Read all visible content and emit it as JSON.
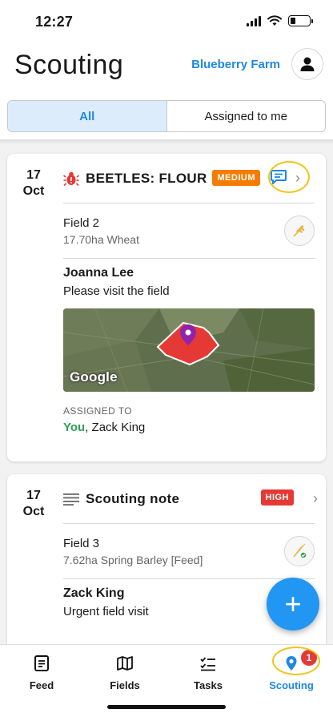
{
  "status_bar": {
    "time": "12:27"
  },
  "header": {
    "title": "Scouting",
    "farm_name": "Blueberry Farm"
  },
  "filter_tabs": [
    {
      "label": "All",
      "active": true
    },
    {
      "label": "Assigned to me",
      "active": false
    }
  ],
  "cards": [
    {
      "date_day": "17",
      "date_month": "Oct",
      "icon": "bug-icon",
      "title": "BEETLES: FLOUR",
      "severity": "MEDIUM",
      "field_name": "Field 2",
      "field_desc": "17.70ha Wheat",
      "author": "Joanna Lee",
      "message": "Please visit the field",
      "map_brand": "Google",
      "assigned_label": "ASSIGNED TO",
      "assigned_you": "You",
      "assigned_others": ", Zack King"
    },
    {
      "date_day": "17",
      "date_month": "Oct",
      "icon": "note-lines-icon",
      "title": "Scouting note",
      "severity": "HIGH",
      "field_name": "Field 3",
      "field_desc": "7.62ha Spring Barley [Feed]",
      "author": "Zack King",
      "message": "Urgent field visit"
    }
  ],
  "fab": {
    "label": "+"
  },
  "bottom_nav": {
    "items": [
      {
        "label": "Feed",
        "icon": "feed-doc-icon"
      },
      {
        "label": "Fields",
        "icon": "map-icon"
      },
      {
        "label": "Tasks",
        "icon": "checklist-icon"
      },
      {
        "label": "Scouting",
        "icon": "location-pin-icon",
        "badge": "1",
        "active": true
      }
    ]
  },
  "colors": {
    "accent": "#1e88e5",
    "medium": "#f57c00",
    "high": "#e53935",
    "assigned_you": "#2e9e5b",
    "annotation": "#f0c419"
  }
}
